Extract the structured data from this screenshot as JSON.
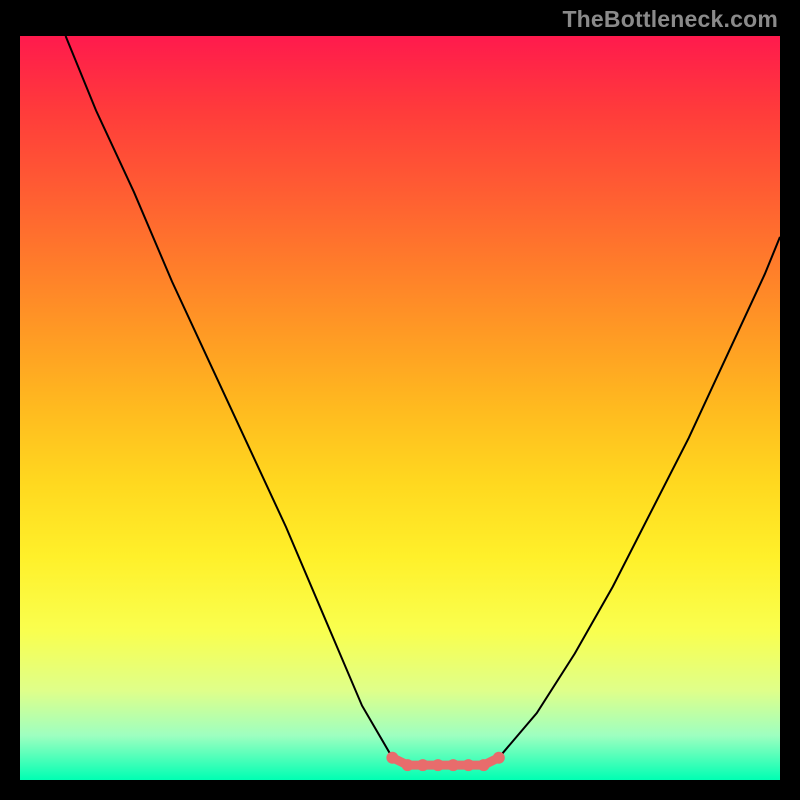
{
  "watermark": "TheBottleneck.com",
  "chart_data": {
    "type": "line",
    "title": "",
    "xlabel": "",
    "ylabel": "",
    "xlim": [
      0,
      100
    ],
    "ylim": [
      0,
      100
    ],
    "grid": false,
    "legend": false,
    "background_gradient": {
      "top": "#ff1a4d",
      "bottom": "#00ffb3"
    },
    "series": [
      {
        "name": "left-branch",
        "color": "#000000",
        "x": [
          6,
          10,
          15,
          20,
          25,
          30,
          35,
          40,
          45,
          49
        ],
        "y": [
          100,
          90,
          79,
          67,
          56,
          45,
          34,
          22,
          10,
          3
        ]
      },
      {
        "name": "flat-bottom",
        "color": "#e86c6c",
        "x": [
          49,
          51,
          53,
          55,
          57,
          59,
          61,
          63
        ],
        "y": [
          3,
          2,
          2,
          2,
          2,
          2,
          2,
          3
        ]
      },
      {
        "name": "right-branch",
        "color": "#000000",
        "x": [
          63,
          68,
          73,
          78,
          83,
          88,
          93,
          98,
          100
        ],
        "y": [
          3,
          9,
          17,
          26,
          36,
          46,
          57,
          68,
          73
        ]
      }
    ],
    "highlight_points": {
      "color": "#e86c6c",
      "x": [
        49,
        51,
        53,
        55,
        57,
        59,
        61,
        63
      ],
      "y": [
        3,
        2,
        2,
        2,
        2,
        2,
        2,
        3
      ]
    }
  }
}
